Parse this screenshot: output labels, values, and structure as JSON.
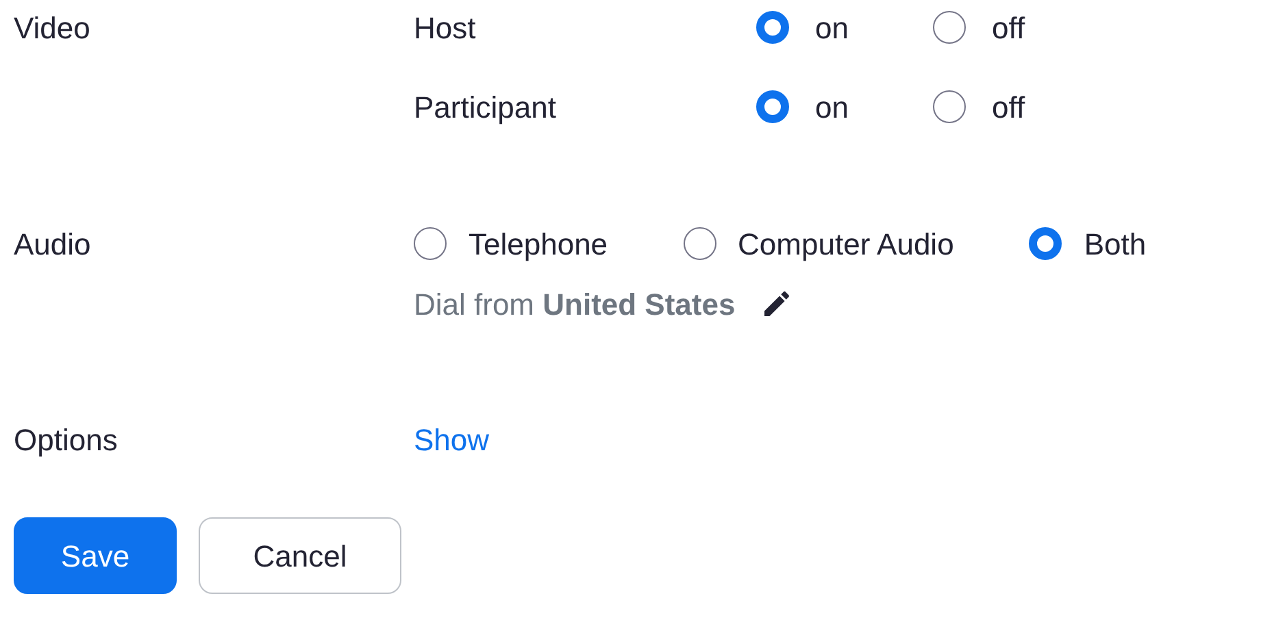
{
  "video": {
    "label": "Video",
    "rows": [
      {
        "label": "Host",
        "options": [
          {
            "label": "on",
            "selected": true
          },
          {
            "label": "off",
            "selected": false
          }
        ]
      },
      {
        "label": "Participant",
        "options": [
          {
            "label": "on",
            "selected": true
          },
          {
            "label": "off",
            "selected": false
          }
        ]
      }
    ]
  },
  "audio": {
    "label": "Audio",
    "options": [
      {
        "label": "Telephone",
        "selected": false
      },
      {
        "label": "Computer Audio",
        "selected": false
      },
      {
        "label": "Both",
        "selected": true
      }
    ],
    "dial": "Dial from **United States**"
  },
  "options": {
    "label": "Options",
    "link": "Show"
  },
  "buttons": [
    {
      "label": "Save",
      "kind": "primary"
    },
    {
      "label": "Cancel",
      "kind": "secondary"
    }
  ]
}
